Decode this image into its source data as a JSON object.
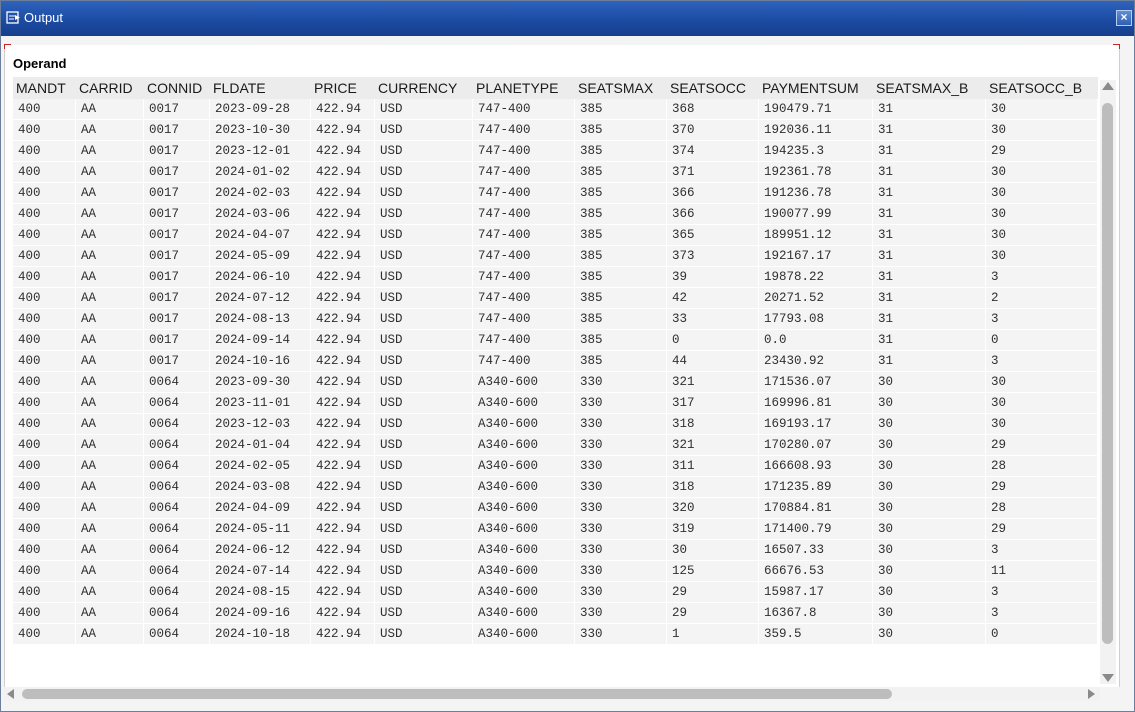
{
  "window": {
    "title": "Output",
    "close_symbol": "×",
    "title_icon": "output-window-icon",
    "titlebar_color": "#1c4ba3"
  },
  "operand_label": "Operand",
  "table": {
    "columns": [
      "MANDT",
      "CARRID",
      "CONNID",
      "FLDATE",
      "PRICE",
      "CURRENCY",
      "PLANETYPE",
      "SEATSMAX",
      "SEATSOCC",
      "PAYMENTSUM",
      "SEATSMAX_B",
      "SEATSOCC_B"
    ],
    "rows": [
      [
        "400",
        "AA",
        "0017",
        "2023-09-28",
        "422.94",
        "USD",
        "747-400",
        "385",
        "368",
        "190479.71",
        "31",
        "30"
      ],
      [
        "400",
        "AA",
        "0017",
        "2023-10-30",
        "422.94",
        "USD",
        "747-400",
        "385",
        "370",
        "192036.11",
        "31",
        "30"
      ],
      [
        "400",
        "AA",
        "0017",
        "2023-12-01",
        "422.94",
        "USD",
        "747-400",
        "385",
        "374",
        "194235.3",
        "31",
        "29"
      ],
      [
        "400",
        "AA",
        "0017",
        "2024-01-02",
        "422.94",
        "USD",
        "747-400",
        "385",
        "371",
        "192361.78",
        "31",
        "30"
      ],
      [
        "400",
        "AA",
        "0017",
        "2024-02-03",
        "422.94",
        "USD",
        "747-400",
        "385",
        "366",
        "191236.78",
        "31",
        "30"
      ],
      [
        "400",
        "AA",
        "0017",
        "2024-03-06",
        "422.94",
        "USD",
        "747-400",
        "385",
        "366",
        "190077.99",
        "31",
        "30"
      ],
      [
        "400",
        "AA",
        "0017",
        "2024-04-07",
        "422.94",
        "USD",
        "747-400",
        "385",
        "365",
        "189951.12",
        "31",
        "30"
      ],
      [
        "400",
        "AA",
        "0017",
        "2024-05-09",
        "422.94",
        "USD",
        "747-400",
        "385",
        "373",
        "192167.17",
        "31",
        "30"
      ],
      [
        "400",
        "AA",
        "0017",
        "2024-06-10",
        "422.94",
        "USD",
        "747-400",
        "385",
        "39",
        "19878.22",
        "31",
        "3"
      ],
      [
        "400",
        "AA",
        "0017",
        "2024-07-12",
        "422.94",
        "USD",
        "747-400",
        "385",
        "42",
        "20271.52",
        "31",
        "2"
      ],
      [
        "400",
        "AA",
        "0017",
        "2024-08-13",
        "422.94",
        "USD",
        "747-400",
        "385",
        "33",
        "17793.08",
        "31",
        "3"
      ],
      [
        "400",
        "AA",
        "0017",
        "2024-09-14",
        "422.94",
        "USD",
        "747-400",
        "385",
        "0",
        "0.0",
        "31",
        "0"
      ],
      [
        "400",
        "AA",
        "0017",
        "2024-10-16",
        "422.94",
        "USD",
        "747-400",
        "385",
        "44",
        "23430.92",
        "31",
        "3"
      ],
      [
        "400",
        "AA",
        "0064",
        "2023-09-30",
        "422.94",
        "USD",
        "A340-600",
        "330",
        "321",
        "171536.07",
        "30",
        "30"
      ],
      [
        "400",
        "AA",
        "0064",
        "2023-11-01",
        "422.94",
        "USD",
        "A340-600",
        "330",
        "317",
        "169996.81",
        "30",
        "30"
      ],
      [
        "400",
        "AA",
        "0064",
        "2023-12-03",
        "422.94",
        "USD",
        "A340-600",
        "330",
        "318",
        "169193.17",
        "30",
        "30"
      ],
      [
        "400",
        "AA",
        "0064",
        "2024-01-04",
        "422.94",
        "USD",
        "A340-600",
        "330",
        "321",
        "170280.07",
        "30",
        "29"
      ],
      [
        "400",
        "AA",
        "0064",
        "2024-02-05",
        "422.94",
        "USD",
        "A340-600",
        "330",
        "311",
        "166608.93",
        "30",
        "28"
      ],
      [
        "400",
        "AA",
        "0064",
        "2024-03-08",
        "422.94",
        "USD",
        "A340-600",
        "330",
        "318",
        "171235.89",
        "30",
        "29"
      ],
      [
        "400",
        "AA",
        "0064",
        "2024-04-09",
        "422.94",
        "USD",
        "A340-600",
        "330",
        "320",
        "170884.81",
        "30",
        "28"
      ],
      [
        "400",
        "AA",
        "0064",
        "2024-05-11",
        "422.94",
        "USD",
        "A340-600",
        "330",
        "319",
        "171400.79",
        "30",
        "29"
      ],
      [
        "400",
        "AA",
        "0064",
        "2024-06-12",
        "422.94",
        "USD",
        "A340-600",
        "330",
        "30",
        "16507.33",
        "30",
        "3"
      ],
      [
        "400",
        "AA",
        "0064",
        "2024-07-14",
        "422.94",
        "USD",
        "A340-600",
        "330",
        "125",
        "66676.53",
        "30",
        "11"
      ],
      [
        "400",
        "AA",
        "0064",
        "2024-08-15",
        "422.94",
        "USD",
        "A340-600",
        "330",
        "29",
        "15987.17",
        "30",
        "3"
      ],
      [
        "400",
        "AA",
        "0064",
        "2024-09-16",
        "422.94",
        "USD",
        "A340-600",
        "330",
        "29",
        "16367.8",
        "30",
        "3"
      ],
      [
        "400",
        "AA",
        "0064",
        "2024-10-18",
        "422.94",
        "USD",
        "A340-600",
        "330",
        "1",
        "359.5",
        "30",
        "0"
      ]
    ]
  },
  "scrollbars": {
    "vertical_icons": [
      "scroll-up-arrow-icon",
      "scroll-down-arrow-icon"
    ],
    "horizontal_icons": [
      "scroll-left-arrow-icon",
      "scroll-right-arrow-icon"
    ]
  }
}
